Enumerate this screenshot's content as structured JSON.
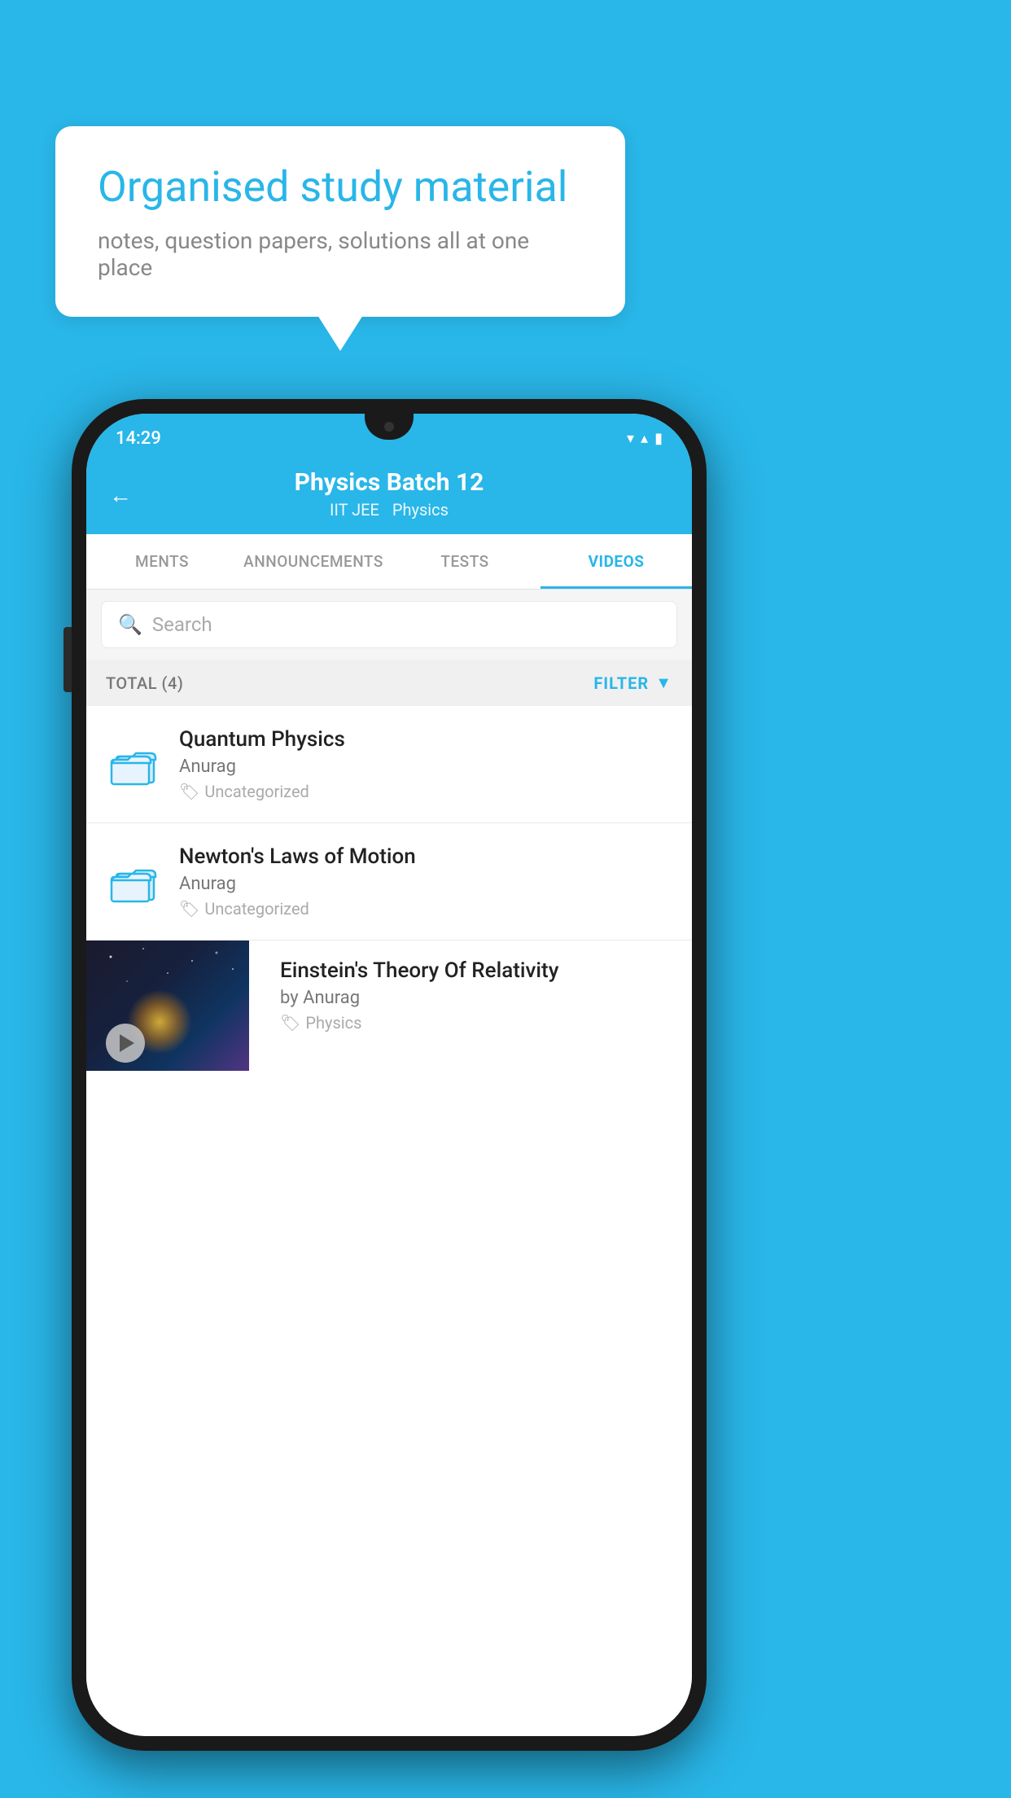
{
  "background_color": "#29b6e8",
  "speech_bubble": {
    "title": "Organised study material",
    "subtitle": "notes, question papers, solutions all at one place"
  },
  "status_bar": {
    "time": "14:29",
    "wifi_icon": "▼",
    "signal_icon": "▲",
    "battery_icon": "▮"
  },
  "header": {
    "title": "Physics Batch 12",
    "subtitle1": "IIT JEE",
    "subtitle2": "Physics",
    "back_label": "←"
  },
  "tabs": [
    {
      "label": "MENTS",
      "active": false
    },
    {
      "label": "ANNOUNCEMENTS",
      "active": false
    },
    {
      "label": "TESTS",
      "active": false
    },
    {
      "label": "VIDEOS",
      "active": true
    }
  ],
  "search": {
    "placeholder": "Search"
  },
  "filter": {
    "total_label": "TOTAL (4)",
    "filter_label": "FILTER"
  },
  "list_items": [
    {
      "title": "Quantum Physics",
      "author": "Anurag",
      "tag": "Uncategorized"
    },
    {
      "title": "Newton's Laws of Motion",
      "author": "Anurag",
      "tag": "Uncategorized"
    }
  ],
  "thumb_item": {
    "title": "Einstein's Theory Of Relativity",
    "author": "by Anurag",
    "tag": "Physics"
  }
}
